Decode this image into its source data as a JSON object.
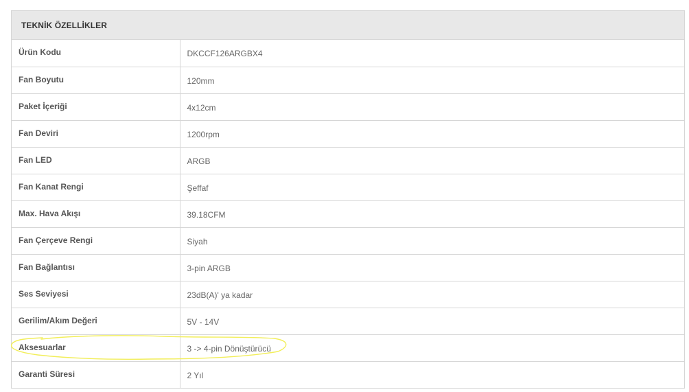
{
  "specs": {
    "title": "TEKNİK ÖZELLİKLER",
    "rows": [
      {
        "label": "Ürün Kodu",
        "value": "DKCCF126ARGBX4"
      },
      {
        "label": "Fan Boyutu",
        "value": "120mm"
      },
      {
        "label": "Paket İçeriği",
        "value": "4x12cm"
      },
      {
        "label": "Fan Deviri",
        "value": "1200rpm"
      },
      {
        "label": "Fan LED",
        "value": "ARGB"
      },
      {
        "label": "Fan Kanat Rengi",
        "value": "Şeffaf"
      },
      {
        "label": "Max. Hava Akışı",
        "value": "39.18CFM"
      },
      {
        "label": "Fan Çerçeve Rengi",
        "value": "Siyah"
      },
      {
        "label": "Fan Bağlantısı",
        "value": "3-pin ARGB"
      },
      {
        "label": "Ses Seviyesi",
        "value": "23dB(A)' ya kadar"
      },
      {
        "label": "Gerilim/Akım Değeri",
        "value": "5V - 14V"
      },
      {
        "label": "Aksesuarlar",
        "value": "3 -> 4-pin Dönüştürücü"
      },
      {
        "label": "Garanti Süresi",
        "value": "2 Yıl"
      }
    ]
  },
  "highlight": {
    "color": "#f2ee5a"
  }
}
